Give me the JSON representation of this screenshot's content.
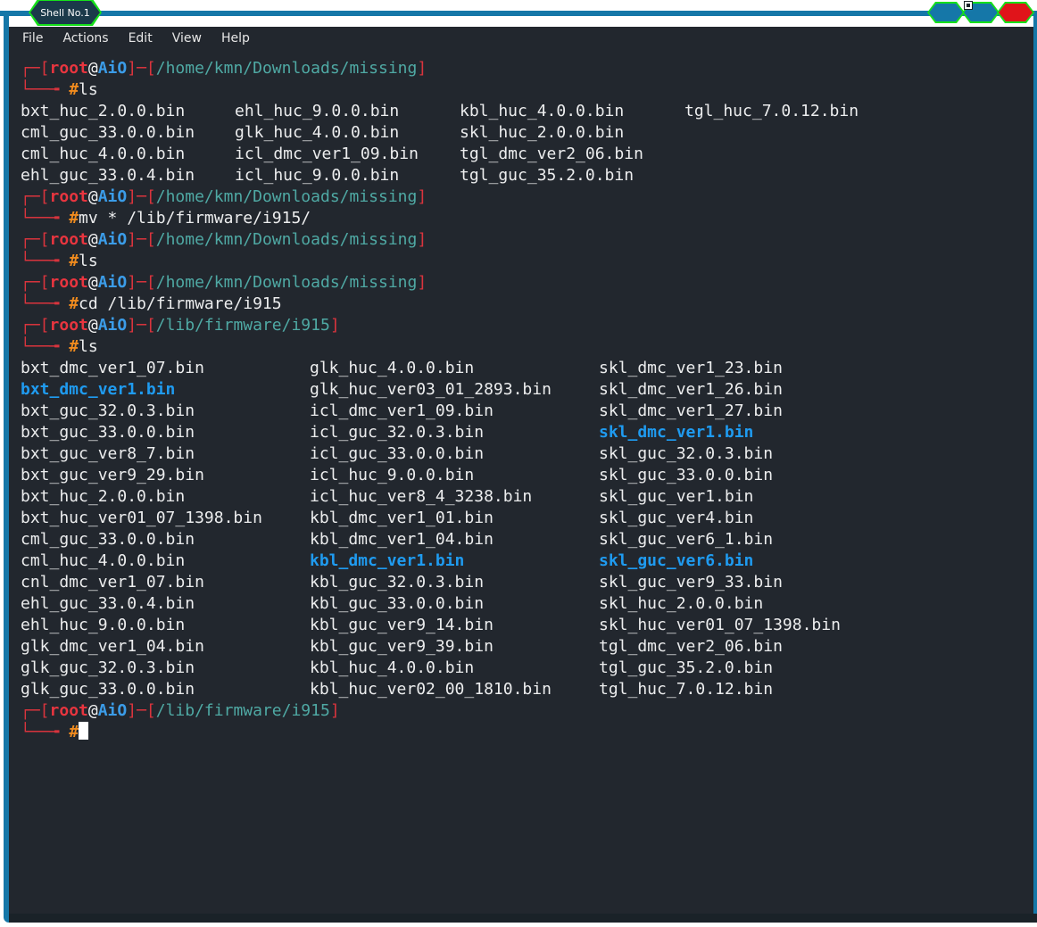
{
  "window": {
    "tab_title": "Shell No.1",
    "accent": "#16e11a",
    "frame_color": "#1577a8",
    "buttons": [
      {
        "name": "minimize",
        "color": "#1577a8"
      },
      {
        "name": "maximize",
        "color": "#1577a8"
      },
      {
        "name": "close",
        "color": "#e0141a"
      }
    ]
  },
  "menu": [
    "File",
    "Actions",
    "Edit",
    "View",
    "Help"
  ],
  "prompt": {
    "user": "root",
    "at": "@",
    "host": "AiO",
    "hash": "#"
  },
  "blocks": [
    {
      "path": "/home/kmn/Downloads/missing",
      "command": "ls"
    },
    {
      "path": "/home/kmn/Downloads/missing",
      "command": "mv * /lib/firmware/i915/"
    },
    {
      "path": "/home/kmn/Downloads/missing",
      "command": "ls"
    },
    {
      "path": "/home/kmn/Downloads/missing",
      "command": "cd /lib/firmware/i915"
    },
    {
      "path": "/lib/firmware/i915",
      "command": "ls"
    },
    {
      "path": "/lib/firmware/i915",
      "command": ""
    }
  ],
  "output1": [
    [
      "bxt_huc_2.0.0.bin",
      "ehl_huc_9.0.0.bin",
      "kbl_huc_4.0.0.bin",
      "tgl_huc_7.0.12.bin"
    ],
    [
      "cml_guc_33.0.0.bin",
      "glk_huc_4.0.0.bin",
      "skl_huc_2.0.0.bin",
      ""
    ],
    [
      "cml_huc_4.0.0.bin",
      "icl_dmc_ver1_09.bin",
      "tgl_dmc_ver2_06.bin",
      ""
    ],
    [
      "ehl_guc_33.0.4.bin",
      "icl_huc_9.0.0.bin",
      "tgl_guc_35.2.0.bin",
      ""
    ]
  ],
  "output2": [
    [
      {
        "t": "bxt_dmc_ver1_07.bin"
      },
      {
        "t": "glk_huc_4.0.0.bin"
      },
      {
        "t": "skl_dmc_ver1_23.bin"
      }
    ],
    [
      {
        "t": "bxt_dmc_ver1.bin",
        "link": true
      },
      {
        "t": "glk_huc_ver03_01_2893.bin"
      },
      {
        "t": "skl_dmc_ver1_26.bin"
      }
    ],
    [
      {
        "t": "bxt_guc_32.0.3.bin"
      },
      {
        "t": "icl_dmc_ver1_09.bin"
      },
      {
        "t": "skl_dmc_ver1_27.bin"
      }
    ],
    [
      {
        "t": "bxt_guc_33.0.0.bin"
      },
      {
        "t": "icl_guc_32.0.3.bin"
      },
      {
        "t": "skl_dmc_ver1.bin",
        "link": true
      }
    ],
    [
      {
        "t": "bxt_guc_ver8_7.bin"
      },
      {
        "t": "icl_guc_33.0.0.bin"
      },
      {
        "t": "skl_guc_32.0.3.bin"
      }
    ],
    [
      {
        "t": "bxt_guc_ver9_29.bin"
      },
      {
        "t": "icl_huc_9.0.0.bin"
      },
      {
        "t": "skl_guc_33.0.0.bin"
      }
    ],
    [
      {
        "t": "bxt_huc_2.0.0.bin"
      },
      {
        "t": "icl_huc_ver8_4_3238.bin"
      },
      {
        "t": "skl_guc_ver1.bin"
      }
    ],
    [
      {
        "t": "bxt_huc_ver01_07_1398.bin"
      },
      {
        "t": "kbl_dmc_ver1_01.bin"
      },
      {
        "t": "skl_guc_ver4.bin"
      }
    ],
    [
      {
        "t": "cml_guc_33.0.0.bin"
      },
      {
        "t": "kbl_dmc_ver1_04.bin"
      },
      {
        "t": "skl_guc_ver6_1.bin"
      }
    ],
    [
      {
        "t": "cml_huc_4.0.0.bin"
      },
      {
        "t": "kbl_dmc_ver1.bin",
        "link": true
      },
      {
        "t": "skl_guc_ver6.bin",
        "link": true
      }
    ],
    [
      {
        "t": "cnl_dmc_ver1_07.bin"
      },
      {
        "t": "kbl_guc_32.0.3.bin"
      },
      {
        "t": "skl_guc_ver9_33.bin"
      }
    ],
    [
      {
        "t": "ehl_guc_33.0.4.bin"
      },
      {
        "t": "kbl_guc_33.0.0.bin"
      },
      {
        "t": "skl_huc_2.0.0.bin"
      }
    ],
    [
      {
        "t": "ehl_huc_9.0.0.bin"
      },
      {
        "t": "kbl_guc_ver9_14.bin"
      },
      {
        "t": "skl_huc_ver01_07_1398.bin"
      }
    ],
    [
      {
        "t": "glk_dmc_ver1_04.bin"
      },
      {
        "t": "kbl_guc_ver9_39.bin"
      },
      {
        "t": "tgl_dmc_ver2_06.bin"
      }
    ],
    [
      {
        "t": "glk_guc_32.0.3.bin"
      },
      {
        "t": "kbl_huc_4.0.0.bin"
      },
      {
        "t": "tgl_guc_35.2.0.bin"
      }
    ],
    [
      {
        "t": "glk_guc_33.0.0.bin"
      },
      {
        "t": "kbl_huc_ver02_00_1810.bin"
      },
      {
        "t": "tgl_huc_7.0.12.bin"
      }
    ]
  ]
}
